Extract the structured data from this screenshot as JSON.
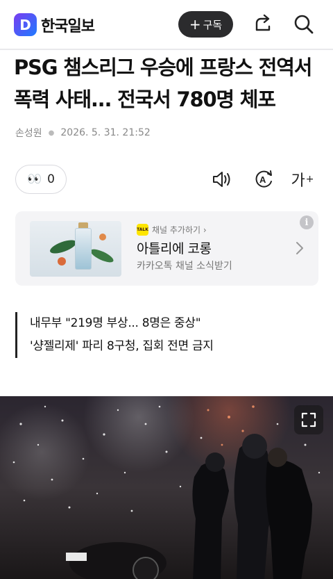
{
  "header": {
    "logo_letter": "D",
    "logo_text": "한국일보",
    "subscribe_label": "구독",
    "colors": {
      "logo_gradient_start": "#7a3cf0",
      "logo_gradient_end": "#1e7bff",
      "subscribe_bg": "#2b2b2d"
    }
  },
  "article": {
    "title": "PSG 챔스리그 우승에 프랑스 전역서 폭력 사태... 전국서 780명 체포",
    "author": "손성원",
    "datetime": "2026. 5. 31. 21:52",
    "reaction_count": "0",
    "font_tool_label": "가",
    "summary": [
      "내무부 \"219명 부상... 8명은 중상\"",
      "'샹젤리제' 파리 8구청, 집회 전면 금지"
    ]
  },
  "ad": {
    "talk_badge": "TALK",
    "channel_label": "채널 추가하기 ›",
    "name": "아틀리에 코롱",
    "subtitle": "카카오톡 채널 소식받기",
    "info_label": "i"
  },
  "icons": [
    "share-icon",
    "search-icon",
    "eyes-emoji",
    "audio-icon",
    "ai-icon",
    "font-size-icon",
    "chevron-right-icon",
    "expand-icon"
  ]
}
